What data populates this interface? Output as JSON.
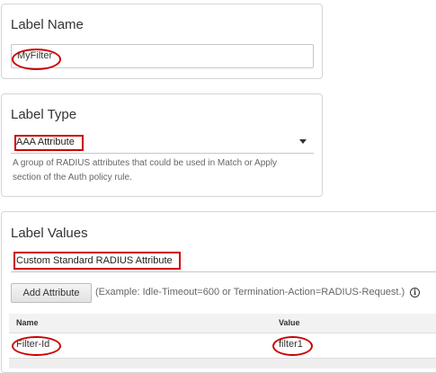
{
  "label_name": {
    "title": "Label Name",
    "value": "MyFilter"
  },
  "label_type": {
    "title": "Label Type",
    "selected": "AAA Attribute",
    "help_text_line1": "A group of RADIUS attributes that could be used in Match or Apply",
    "help_text_line2": "section of the Auth policy rule."
  },
  "label_values": {
    "title": "Label Values",
    "attribute_type": "Custom Standard RADIUS Attribute",
    "add_button_label": "Add Attribute",
    "example_text": "(Example: Idle-Timeout=600 or Termination-Action=RADIUS-Request.)",
    "info_icon_glyph": "i",
    "table": {
      "headers": [
        "Name",
        "Value"
      ],
      "rows": [
        {
          "name": "Filter-Id",
          "value": "filter1"
        }
      ]
    }
  },
  "colors": {
    "annotation": "#cc0000",
    "panel_border": "#d5d5d5",
    "table_header_bg": "#f2f2f2"
  },
  "icons": {
    "dropdown": "chevron-down-icon",
    "info": "info-icon"
  }
}
